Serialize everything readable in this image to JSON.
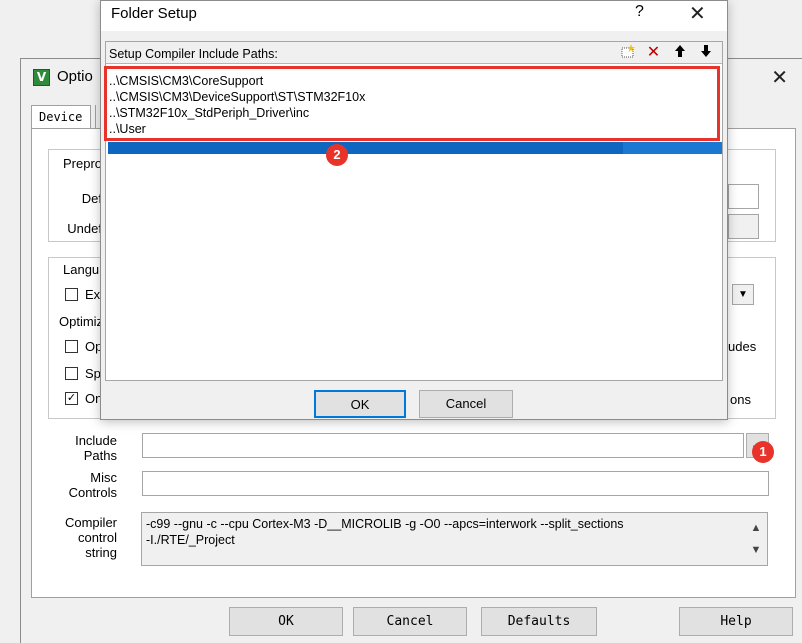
{
  "folder_setup": {
    "title": "Folder Setup",
    "help_glyph": "?",
    "close_glyph": "✕",
    "list_header": "Setup Compiler Include Paths:",
    "paths": [
      "..\\CMSIS\\CM3\\CoreSupport",
      "..\\CMSIS\\CM3\\DeviceSupport\\ST\\STM32F10x",
      "..\\STM32F10x_StdPeriph_Driver\\inc",
      "..\\User"
    ],
    "ok_label": "OK",
    "cancel_label": "Cancel",
    "accent_color": "#e8332a",
    "selection_color": "#1a78d2"
  },
  "options_window": {
    "title_visible": "Optio",
    "close_glyph": "✕",
    "tab_device": "Device",
    "preprocessor_group": "Prepro",
    "define_label": "Def",
    "undefine_label": "Undef",
    "language_group": "Langu",
    "execute_only_label": "Exe",
    "optimization_label": "Optimiz",
    "opt_checkbox_label": "Op",
    "split_checkbox_label": "Spl",
    "one_checkbox_label": "On",
    "one_checkbox_mark": "✓",
    "right_text_1": "udes",
    "right_text_2": "ons",
    "include_paths_label_1": "Include",
    "include_paths_label_2": "Paths",
    "browse_button": "...",
    "misc_controls_label_1": "Misc",
    "misc_controls_label_2": "Controls",
    "compiler_label_1": "Compiler",
    "compiler_label_2": "control",
    "compiler_label_3": "string",
    "compiler_string_line1": "-c99 --gnu -c --cpu Cortex-M3 -D__MICROLIB -g -O0 --apcs=interwork --split_sections",
    "compiler_string_line2": "-I./RTE/_Project",
    "ok_button": "OK",
    "cancel_button": "Cancel",
    "defaults_button": "Defaults",
    "help_button": "Help"
  },
  "annotations": {
    "badge_1": "1",
    "badge_2": "2"
  }
}
